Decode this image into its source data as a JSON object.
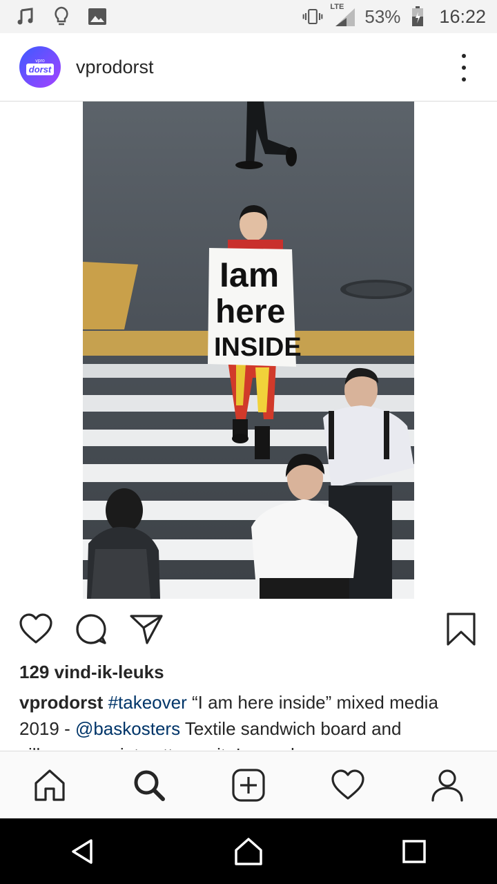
{
  "status_bar": {
    "left_icons": [
      "music-note-icon",
      "lightbulb-icon",
      "image-icon"
    ],
    "right_icons": [
      "vibrate-icon",
      "lte-signal-icon",
      "battery-icon"
    ],
    "network_label": "LTE",
    "battery": "53%",
    "time": "16:22"
  },
  "post_header": {
    "avatar_small_text": "vpro",
    "avatar_brand": "dorst",
    "username": "vprodorst",
    "menu_icon": "more-vertical-icon"
  },
  "photo": {
    "sign_lines": [
      "Iam",
      "here",
      "INSIDE"
    ]
  },
  "actions": {
    "icons": [
      "heart-icon",
      "comment-icon",
      "share-icon",
      "bookmark-icon"
    ]
  },
  "likes": "129 vind-ik-leuks",
  "caption": {
    "username": "vprodorst",
    "hashtag": "#takeover",
    "text_1": " “I am here inside”  mixed media 2019 - ",
    "mention": "@baskosters",
    "text_2": "  Textile sandwich board and silkscreen print cotton suit. Image by"
  },
  "bottom_nav": [
    "home-icon",
    "search-icon",
    "add-post-icon",
    "activity-heart-icon",
    "profile-icon"
  ],
  "system_nav": [
    "back-icon",
    "home-circle-icon",
    "recents-icon"
  ],
  "colors": {
    "text": "#262626",
    "link": "#003569",
    "avatar_gradient_start": "#3d5bff",
    "avatar_gradient_end": "#a442ff"
  }
}
